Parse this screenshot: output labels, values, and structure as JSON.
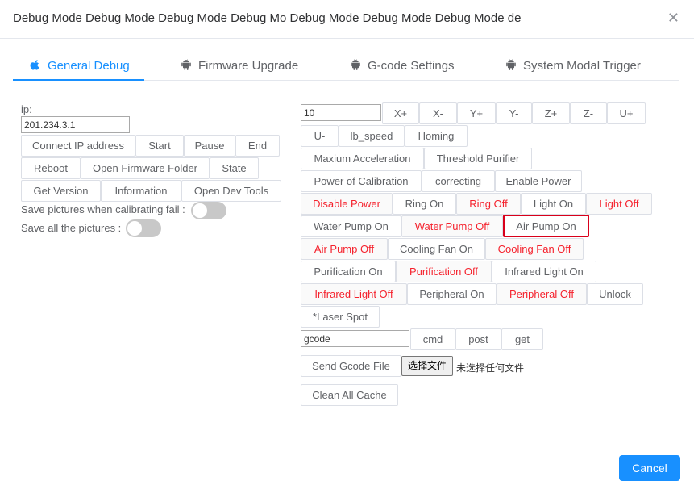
{
  "modal": {
    "title": "Debug Mode Debug Mode Debug Mode Debug Mo Debug Mode Debug Mode Debug Mode de",
    "close_icon": "close-icon"
  },
  "tabs": [
    {
      "label": "General Debug",
      "icon": "apple-icon",
      "active": true
    },
    {
      "label": "Firmware Upgrade",
      "icon": "android-icon",
      "active": false
    },
    {
      "label": "G-code Settings",
      "icon": "android-icon",
      "active": false
    },
    {
      "label": "System Modal Trigger",
      "icon": "android-icon",
      "active": false
    }
  ],
  "left": {
    "ip_label": "ip:",
    "ip_value": "201.234.3.1",
    "buttons": [
      "Connect IP address",
      "Start",
      "Pause",
      "End",
      "Reboot",
      "Open Firmware Folder",
      "State",
      "Get Version",
      "Information",
      "Open Dev Tools"
    ],
    "save_fail_label": "Save pictures when calibrating fail :",
    "save_all_label": "Save all the pictures :",
    "save_fail_on": false,
    "save_all_on": false
  },
  "right": {
    "step_value": "10",
    "buttons": [
      "X+",
      "X-",
      "Y+",
      "Y-",
      "Z+",
      "Z-",
      "U+",
      "U-",
      "lb_speed",
      "Homing",
      "Maxium Acceleration",
      "Threshold Purifier",
      "Power of Calibration",
      "correcting",
      "Enable Power",
      "Disable Power",
      "Ring On",
      "Ring Off",
      "Light On",
      "Light Off",
      "Water Pump On",
      "Water Pump Off",
      "Air Pump On",
      "Air Pump Off",
      "Cooling Fan On",
      "Cooling Fan Off",
      "Purification On",
      "Purification Off",
      "Infrared Light On",
      "Infrared Light Off",
      "Peripheral On",
      "Peripheral Off",
      "Unlock",
      "*Laser Spot"
    ],
    "gcode_value": "gcode",
    "gcode_buttons": [
      "cmd",
      "post",
      "get"
    ],
    "send_gcode_label": "Send Gcode File",
    "file_button_label": "选择文件",
    "file_none_label": "未选择任何文件",
    "clean_cache_label": "Clean All Cache",
    "off_color": "#f5222d"
  },
  "footer": {
    "cancel_label": "Cancel"
  },
  "colors": {
    "accent": "#1890ff",
    "danger": "#f5222d",
    "highlight_border": "#d9001b"
  }
}
